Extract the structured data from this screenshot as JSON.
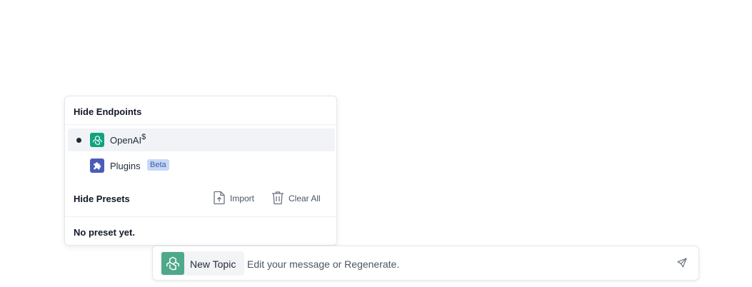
{
  "menu": {
    "endpoints_header": "Hide Endpoints",
    "endpoints": [
      {
        "label": "OpenAI",
        "superscript": "$",
        "selected": true,
        "icon": "openai-icon",
        "icon_color": "#10a37f"
      },
      {
        "label": "Plugins",
        "badge": "Beta",
        "selected": false,
        "icon": "puzzle-icon",
        "icon_color": "#4b5cb8"
      }
    ],
    "presets_header": "Hide Presets",
    "import_label": "Import",
    "clear_all_label": "Clear All",
    "empty_presets": "No preset yet."
  },
  "input_bar": {
    "topic_label": "New Topic",
    "placeholder": "Edit your message or Regenerate.",
    "value": "",
    "topic_icon": "openai-icon",
    "topic_icon_color": "#4fa88a",
    "send_icon": "send-icon"
  },
  "colors": {
    "badge_bg": "#c7d8f7",
    "badge_text": "#3b5bab",
    "selected_bg": "#f1f3f7"
  }
}
